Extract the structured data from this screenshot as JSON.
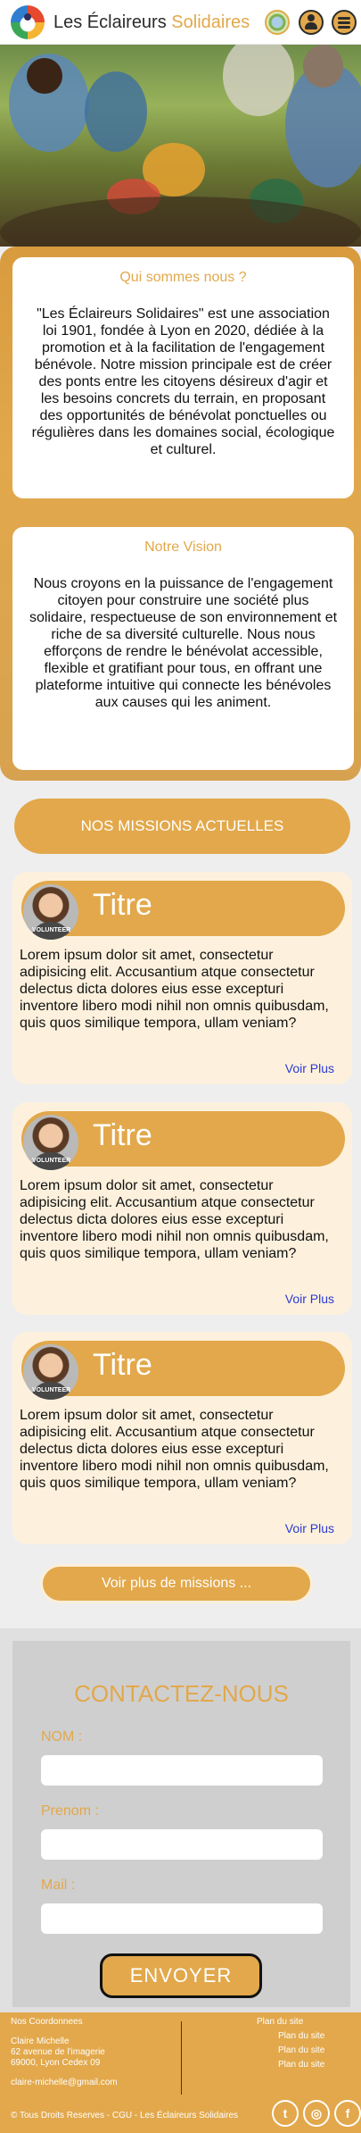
{
  "header": {
    "brand_main": "Les Éclaireurs",
    "brand_accent": "Solidaires"
  },
  "about": {
    "who_title": "Qui sommes nous ?",
    "who_text": "\"Les Éclaireurs Solidaires\" est une association loi 1901, fondée à Lyon en 2020, dédiée à la promotion et à la facilitation de l'engagement bénévole. Notre mission principale est de créer des ponts entre les citoyens désireux d'agir et les besoins concrets du terrain, en proposant des opportunités de bénévolat ponctuelles ou régulières dans les domaines social, écologique et culturel.",
    "vision_title": "Notre Vision",
    "vision_text": "Nous croyons en la puissance de l'engagement citoyen pour construire une société plus solidaire, respectueuse de son environnement et riche de sa diversité culturelle. Nous nous efforçons de rendre le bénévolat accessible, flexible et gratifiant pour tous, en offrant une plateforme intuitive qui connecte les bénévoles aux causes qui les animent."
  },
  "missions": {
    "heading": "NOS MISSIONS ACTUELLES",
    "items": [
      {
        "title": "Titre",
        "badge": "VOLUNTEER",
        "text": "Lorem ipsum dolor sit amet, consectetur adipisicing elit. Accusantium atque consectetur delectus dicta dolores eius esse excepturi inventore libero modi nihil non omnis quibusdam, quis quos similique tempora, ullam veniam?",
        "more": "Voir Plus"
      },
      {
        "title": "Titre",
        "badge": "VOLUNTEER",
        "text": "Lorem ipsum dolor sit amet, consectetur adipisicing elit. Accusantium atque consectetur delectus dicta dolores eius esse excepturi inventore libero modi nihil non omnis quibusdam, quis quos similique tempora, ullam veniam?",
        "more": "Voir Plus"
      },
      {
        "title": "Titre",
        "badge": "VOLUNTEER",
        "text": "Lorem ipsum dolor sit amet, consectetur adipisicing elit. Accusantium atque consectetur delectus dicta dolores eius esse excepturi inventore libero modi nihil non omnis quibusdam, quis quos similique tempora, ullam veniam?",
        "more": "Voir Plus"
      }
    ],
    "see_more": "Voir plus de missions ..."
  },
  "contact": {
    "title": "CONTACTEZ-NOUS",
    "nom_label": "NOM :",
    "prenom_label": "Prenom :",
    "mail_label": "Mail :",
    "send_label": "ENVOYER"
  },
  "footer": {
    "coords_title": "Nos Coordonnees",
    "name": "Claire Michelle",
    "address1": "62 avenue de l'imagerie",
    "address2": "69000, Lyon Cedex 09",
    "email": "claire-michelle@gmail.com",
    "sitemap": [
      "Plan du site",
      "Plan du site",
      "Plan du site",
      "Plan du site"
    ],
    "copyright": "© Tous Droits Reserves - CGU - Les Éclaireurs Solidaires"
  },
  "colors": {
    "accent": "#e2a84b",
    "card_bg": "#fdf1dd",
    "link": "#2d3ad3"
  },
  "icons": {
    "logo": "logo-icon",
    "globe": "globe-icon",
    "user": "user-icon",
    "menu": "menu-icon",
    "twitter": "twitter-icon",
    "instagram": "instagram-icon",
    "facebook": "facebook-icon"
  }
}
